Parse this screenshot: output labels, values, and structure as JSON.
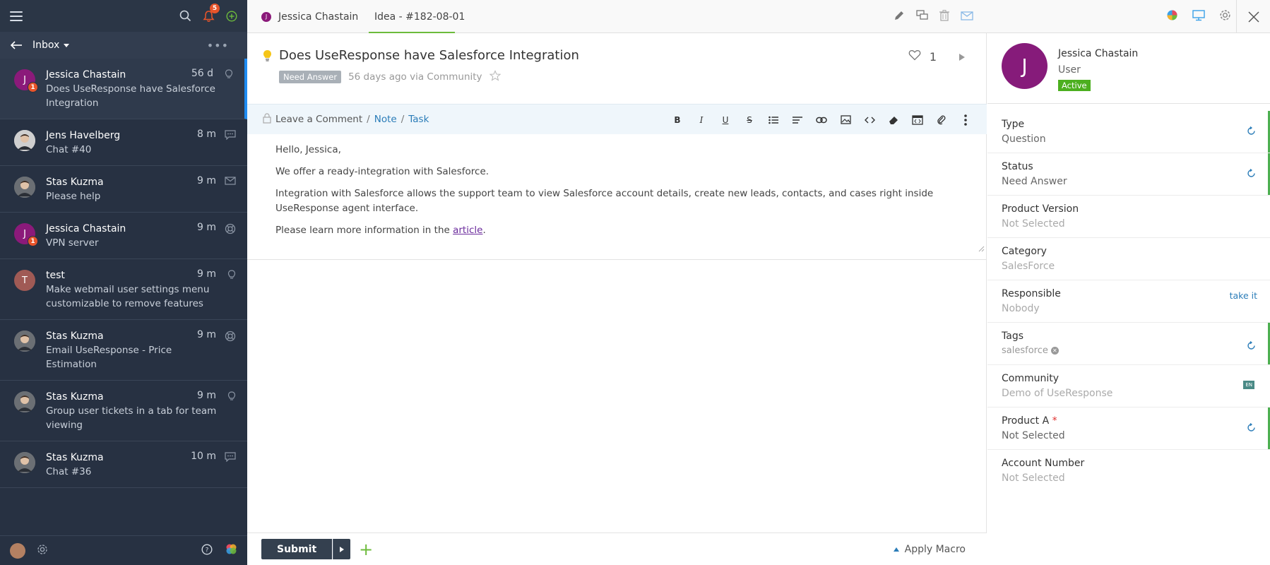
{
  "sidebar": {
    "notifications_count": "5",
    "inbox_label": "Inbox",
    "conversations": [
      {
        "name": "Jessica Chastain",
        "preview": "Does UseResponse have Salesforce Integration",
        "time": "56 d",
        "avatar_letter": "J",
        "avatar_color": "#8b1a7a",
        "badge": "1",
        "icon": "bulb-icon",
        "active": true
      },
      {
        "name": "Jens Havelberg",
        "preview": "Chat #40",
        "time": "8 m",
        "avatar_letter": "",
        "avatar_color": "#cfcfcf",
        "icon": "chat-icon"
      },
      {
        "name": "Stas Kuzma",
        "preview": "Please help",
        "time": "9 m",
        "avatar_letter": "",
        "avatar_color": "#6b6f74",
        "icon": "mail-icon"
      },
      {
        "name": "Jessica Chastain",
        "preview": "VPN server",
        "time": "9 m",
        "avatar_letter": "J",
        "avatar_color": "#8b1a7a",
        "badge": "1",
        "icon": "lifebuoy-icon"
      },
      {
        "name": "test",
        "preview": "Make webmail user settings menu customizable to remove features",
        "time": "9 m",
        "avatar_letter": "T",
        "avatar_color": "#a05a55",
        "icon": "bulb-icon"
      },
      {
        "name": "Stas Kuzma",
        "preview": "Email UseResponse - Price Estimation",
        "time": "9 m",
        "avatar_letter": "",
        "avatar_color": "#6b6f74",
        "icon": "lifebuoy-icon"
      },
      {
        "name": "Stas Kuzma",
        "preview": "Group user tickets in a tab for team viewing",
        "time": "9 m",
        "avatar_letter": "",
        "avatar_color": "#6b6f74",
        "icon": "bulb-icon"
      },
      {
        "name": "Stas Kuzma",
        "preview": "Chat #36",
        "time": "10 m",
        "avatar_letter": "",
        "avatar_color": "#6b6f74",
        "icon": "chat-icon"
      }
    ]
  },
  "topbar": {
    "user_tab": "Jessica Chastain",
    "user_tab_initial": "J",
    "idea_tab": "Idea - #182-08-01"
  },
  "ticket": {
    "title": "Does UseResponse have Salesforce Integration",
    "status": "Need Answer",
    "meta": "56 days ago via Community",
    "likes": "1"
  },
  "editor": {
    "leave_comment": "Leave a Comment",
    "sep": "/",
    "note": "Note",
    "task": "Task",
    "body": {
      "p1": "Hello, Jessica,",
      "p2": "We offer a ready-integration with Salesforce.",
      "p3": "Integration with Salesforce allows the support team to view Salesforce account details, create new leads, contacts, and cases right inside UseResponse agent interface.",
      "p4_prefix": "Please learn more information in the ",
      "p4_link": "article",
      "p4_suffix": "."
    }
  },
  "footer": {
    "submit": "Submit",
    "apply_macro": "Apply Macro"
  },
  "profile": {
    "initial": "J",
    "name": "Jessica Chastain",
    "role": "User",
    "status": "Active"
  },
  "fields": {
    "type": {
      "label": "Type",
      "value": "Question"
    },
    "status": {
      "label": "Status",
      "value": "Need Answer"
    },
    "product_version": {
      "label": "Product Version",
      "value": "Not Selected"
    },
    "category": {
      "label": "Category",
      "value": "SalesForce"
    },
    "responsible": {
      "label": "Responsible",
      "value": "Nobody",
      "action": "take it"
    },
    "tags": {
      "label": "Tags",
      "tag": "salesforce"
    },
    "community": {
      "label": "Community",
      "value": "Demo of UseResponse",
      "lang": "EN"
    },
    "product_a": {
      "label": "Product A",
      "required_mark": "*",
      "value": "Not Selected"
    },
    "account_number": {
      "label": "Account Number",
      "value": "Not Selected"
    }
  },
  "colors": {
    "sidebar_bg": "#273142",
    "active_accent": "#1f8cf2",
    "status_active": "#4caf1f",
    "link": "#2a7cb8",
    "success": "#6dbb3c"
  }
}
